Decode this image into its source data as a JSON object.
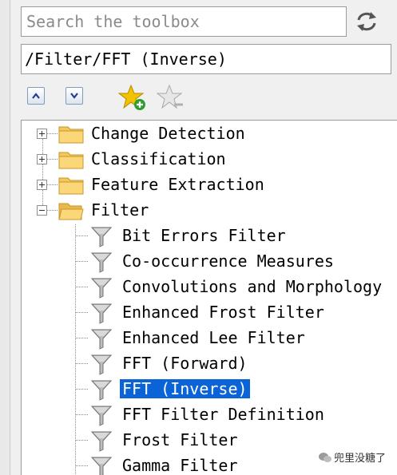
{
  "search": {
    "placeholder": "Search the toolbox"
  },
  "path": {
    "value": "/Filter/FFT (Inverse)"
  },
  "toolbar": {
    "up_icon": "chevron-up-icon",
    "down_icon": "chevron-down-icon",
    "add_favorite_icon": "star-add-icon",
    "remove_favorite_icon": "star-remove-icon"
  },
  "tree": {
    "folders": [
      {
        "label": "Change Detection",
        "expanded": false
      },
      {
        "label": "Classification",
        "expanded": false
      },
      {
        "label": "Feature Extraction",
        "expanded": false
      },
      {
        "label": "Filter",
        "expanded": true
      }
    ],
    "filter_items": [
      {
        "label": "Bit Errors Filter"
      },
      {
        "label": "Co-occurrence Measures"
      },
      {
        "label": "Convolutions and Morphology"
      },
      {
        "label": "Enhanced Frost Filter"
      },
      {
        "label": "Enhanced Lee Filter"
      },
      {
        "label": "FFT (Forward)"
      },
      {
        "label": "FFT (Inverse)",
        "selected": true
      },
      {
        "label": "FFT Filter Definition"
      },
      {
        "label": "Frost Filter"
      },
      {
        "label": "Gamma Filter"
      }
    ]
  },
  "watermark": {
    "text": "兜里没糖了"
  },
  "colors": {
    "selection": "#0a64d8",
    "folder": "#f5c65b"
  }
}
